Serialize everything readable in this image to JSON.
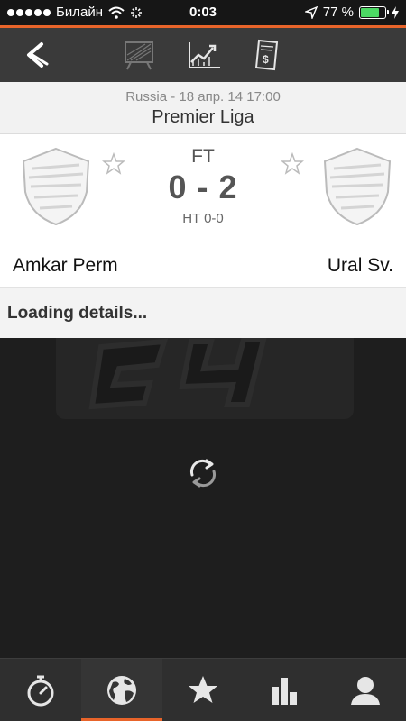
{
  "status_bar": {
    "carrier": "Билайн",
    "time": "0:03",
    "battery_percent_label": "77 %",
    "battery_level": 0.77
  },
  "toolbar": {
    "back_icon": "back-arrow-icon",
    "items": [
      "chart-board-icon",
      "stats-graph-icon",
      "odds-document-icon"
    ]
  },
  "match": {
    "meta": "Russia - 18 апр. 14  17:00",
    "league": "Premier Liga",
    "status": "FT",
    "score": "0 - 2",
    "halftime": "HT 0-0",
    "home_team": "Amkar Perm",
    "away_team": "Ural Sv."
  },
  "loading": {
    "text": "Loading details..."
  },
  "tabbar": {
    "items": [
      "stopwatch-icon",
      "globe-icon",
      "star-icon",
      "standings-icon",
      "profile-icon"
    ],
    "active_index": 1
  },
  "colors": {
    "accent": "#e8642a",
    "toolbar_bg": "#3a3a3a",
    "dark_bg": "#1e1e1e"
  }
}
